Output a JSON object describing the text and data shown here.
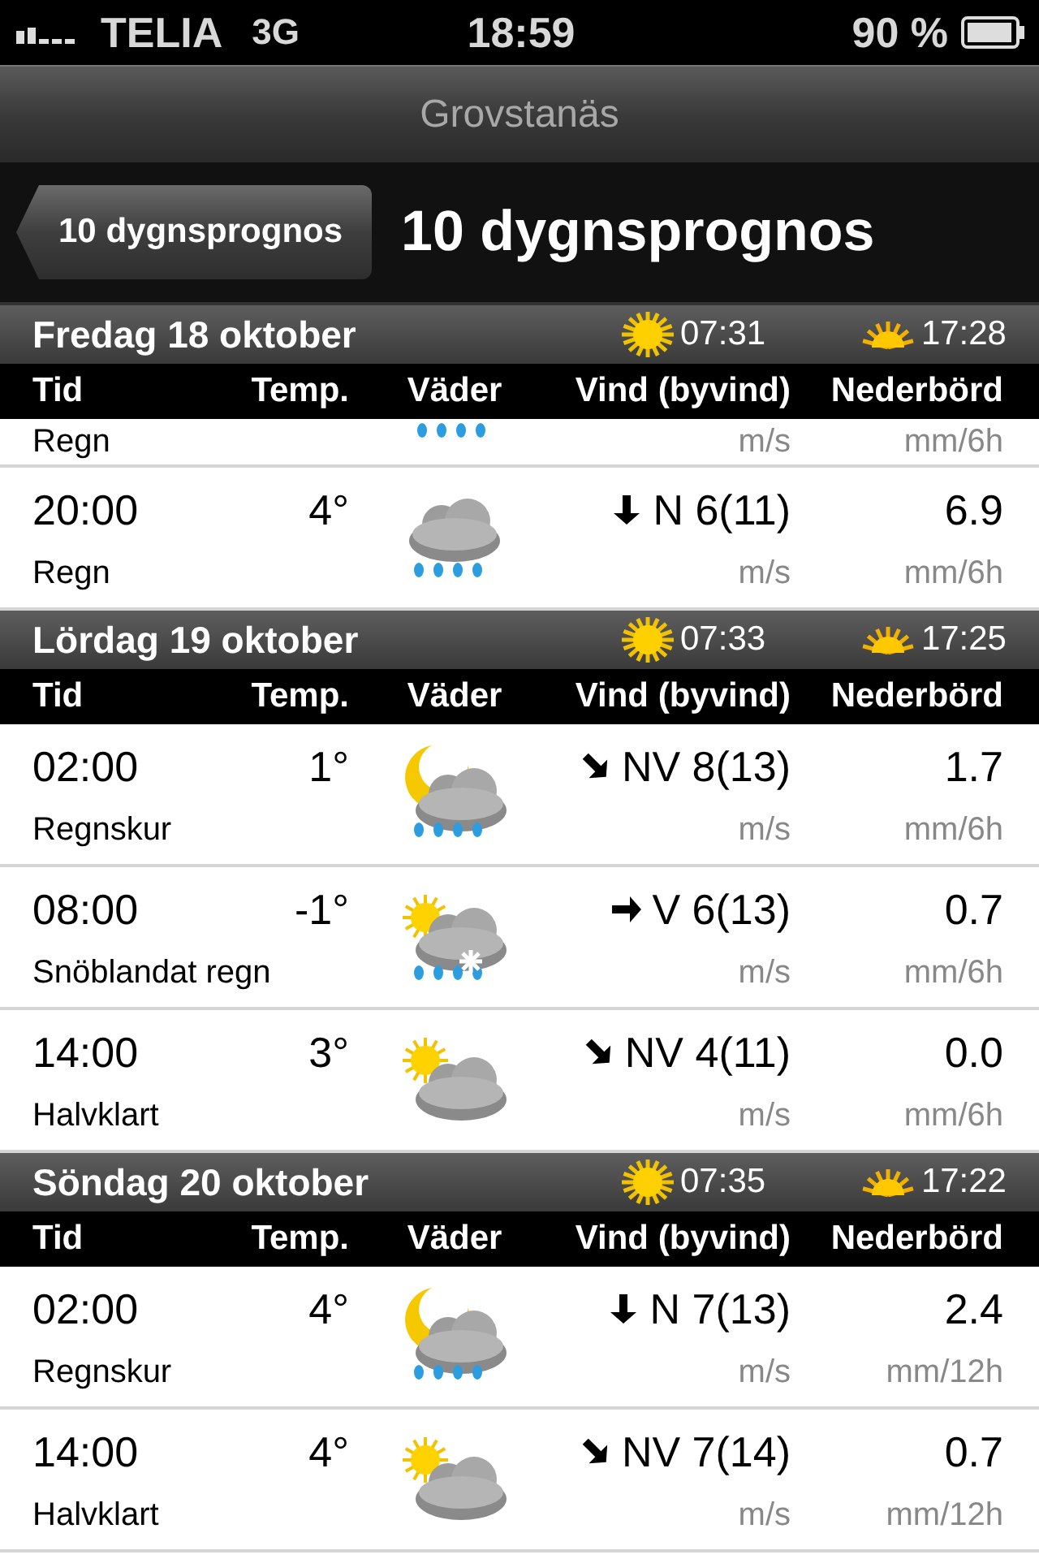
{
  "status_bar": {
    "carrier": "TELIA",
    "network": "3G",
    "time": "18:59",
    "battery": "90 %"
  },
  "title_bar": {
    "title": "Grovstanäs"
  },
  "nav_bar": {
    "back_button": "10 dygnsprognos",
    "title": "10 dygnsprognos"
  },
  "days": [
    {
      "title": "Fredag 18 oktober",
      "sunrise": "07:31",
      "sunset": "17:28",
      "columns": [
        "Tid",
        "Temp.",
        "Väder",
        "Vind (byvind)",
        "Nederbörd"
      ],
      "rows": [
        {
          "kind": "partial",
          "description": "Regn",
          "weather": {
            "kind": "rain"
          },
          "wind_unit": "m/s",
          "precip_unit": "mm/6h"
        },
        {
          "kind": "full",
          "time": "20:00",
          "temp": "4°",
          "description": "Regn",
          "weather": {
            "kind": "rain"
          },
          "arrow": {
            "kind": "down"
          },
          "wind": "N 6(11)",
          "wind_unit": "m/s",
          "precip": "6.9",
          "precip_unit": "mm/6h"
        }
      ]
    },
    {
      "title": "Lördag 19 oktober",
      "sunrise": "07:33",
      "sunset": "17:25",
      "columns": [
        "Tid",
        "Temp.",
        "Väder",
        "Vind (byvind)",
        "Nederbörd"
      ],
      "rows": [
        {
          "kind": "full",
          "time": "02:00",
          "temp": "1°",
          "description": "Regnskur",
          "weather": {
            "kind": "moon-rain"
          },
          "arrow": {
            "kind": "down-right"
          },
          "wind": "NV 8(13)",
          "wind_unit": "m/s",
          "precip": "1.7",
          "precip_unit": "mm/6h"
        },
        {
          "kind": "full",
          "time": "08:00",
          "temp": "-1°",
          "description": "Snöblandat regn",
          "weather": {
            "kind": "sun-sleet"
          },
          "arrow": {
            "kind": "right"
          },
          "wind": "V 6(13)",
          "wind_unit": "m/s",
          "precip": "0.7",
          "precip_unit": "mm/6h"
        },
        {
          "kind": "full",
          "time": "14:00",
          "temp": "3°",
          "description": "Halvklart",
          "weather": {
            "kind": "sun-cloud"
          },
          "arrow": {
            "kind": "down-right"
          },
          "wind": "NV 4(11)",
          "wind_unit": "m/s",
          "precip": "0.0",
          "precip_unit": "mm/6h"
        }
      ]
    },
    {
      "title": "Söndag 20 oktober",
      "sunrise": "07:35",
      "sunset": "17:22",
      "columns": [
        "Tid",
        "Temp.",
        "Väder",
        "Vind (byvind)",
        "Nederbörd"
      ],
      "rows": [
        {
          "kind": "full",
          "time": "02:00",
          "temp": "4°",
          "description": "Regnskur",
          "weather": {
            "kind": "moon-rain"
          },
          "arrow": {
            "kind": "down"
          },
          "wind": "N 7(13)",
          "wind_unit": "m/s",
          "precip": "2.4",
          "precip_unit": "mm/12h"
        },
        {
          "kind": "full",
          "time": "14:00",
          "temp": "4°",
          "description": "Halvklart",
          "weather": {
            "kind": "sun-cloud"
          },
          "arrow": {
            "kind": "down-right"
          },
          "wind": "NV 7(14)",
          "wind_unit": "m/s",
          "precip": "0.7",
          "precip_unit": "mm/12h"
        }
      ]
    }
  ]
}
